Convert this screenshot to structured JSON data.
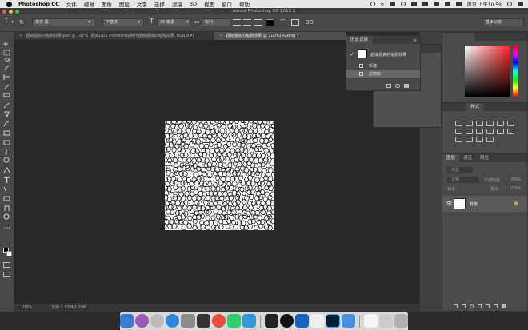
{
  "menubar": {
    "app_name": "Photoshop CC",
    "items": [
      "文件",
      "编辑",
      "图像",
      "图层",
      "文字",
      "选择",
      "滤镜",
      "3D",
      "视图",
      "窗口",
      "帮助"
    ],
    "status_badge": "6",
    "clock": "周日 上午10:59"
  },
  "window": {
    "title": "Adobe Photoshop CC 2015.5"
  },
  "options_bar": {
    "font_family": "华方-黑",
    "font_style": "中基体",
    "font_size": "36 像素",
    "anti_alias": "锐利",
    "workspace": "基本功能"
  },
  "tabs": [
    {
      "label": "超级逼真的龟裂效果.psd @ 167% (隔离DD1 Photoshop制作超级逼真的龟裂效果, RGB/8#)",
      "active": false
    },
    {
      "label": "超级逼真的龟裂效果 @ 100%(RGB/8) *",
      "active": true
    }
  ],
  "status_bar": {
    "zoom": "100%",
    "doc_info": "文档:1.03M/1.03M"
  },
  "history_panel": {
    "tab_label": "历史记录",
    "snapshot_label": "超级逼真的龟裂效果",
    "items": [
      {
        "label": "新建",
        "selected": false
      },
      {
        "label": "滤镜库",
        "selected": true
      }
    ]
  },
  "properties_panel": {
    "tabs": [
      "属性",
      "调整"
    ]
  },
  "adjust_panel": {
    "tab_label": "样式"
  },
  "layers_panel": {
    "tabs": [
      "图层",
      "通道",
      "路径"
    ],
    "filter_placeholder": "类型",
    "mode": "正常",
    "opacity_label": "不透明度:",
    "opacity_value": "100%",
    "lock_label": "锁定:",
    "fill_label": "填充:",
    "fill_value": "100%",
    "layers": [
      {
        "name": "背景",
        "visible": true,
        "locked": true
      }
    ]
  },
  "colors": {
    "accent": "#f5a623",
    "picker_hue": "#ff2a2a"
  }
}
